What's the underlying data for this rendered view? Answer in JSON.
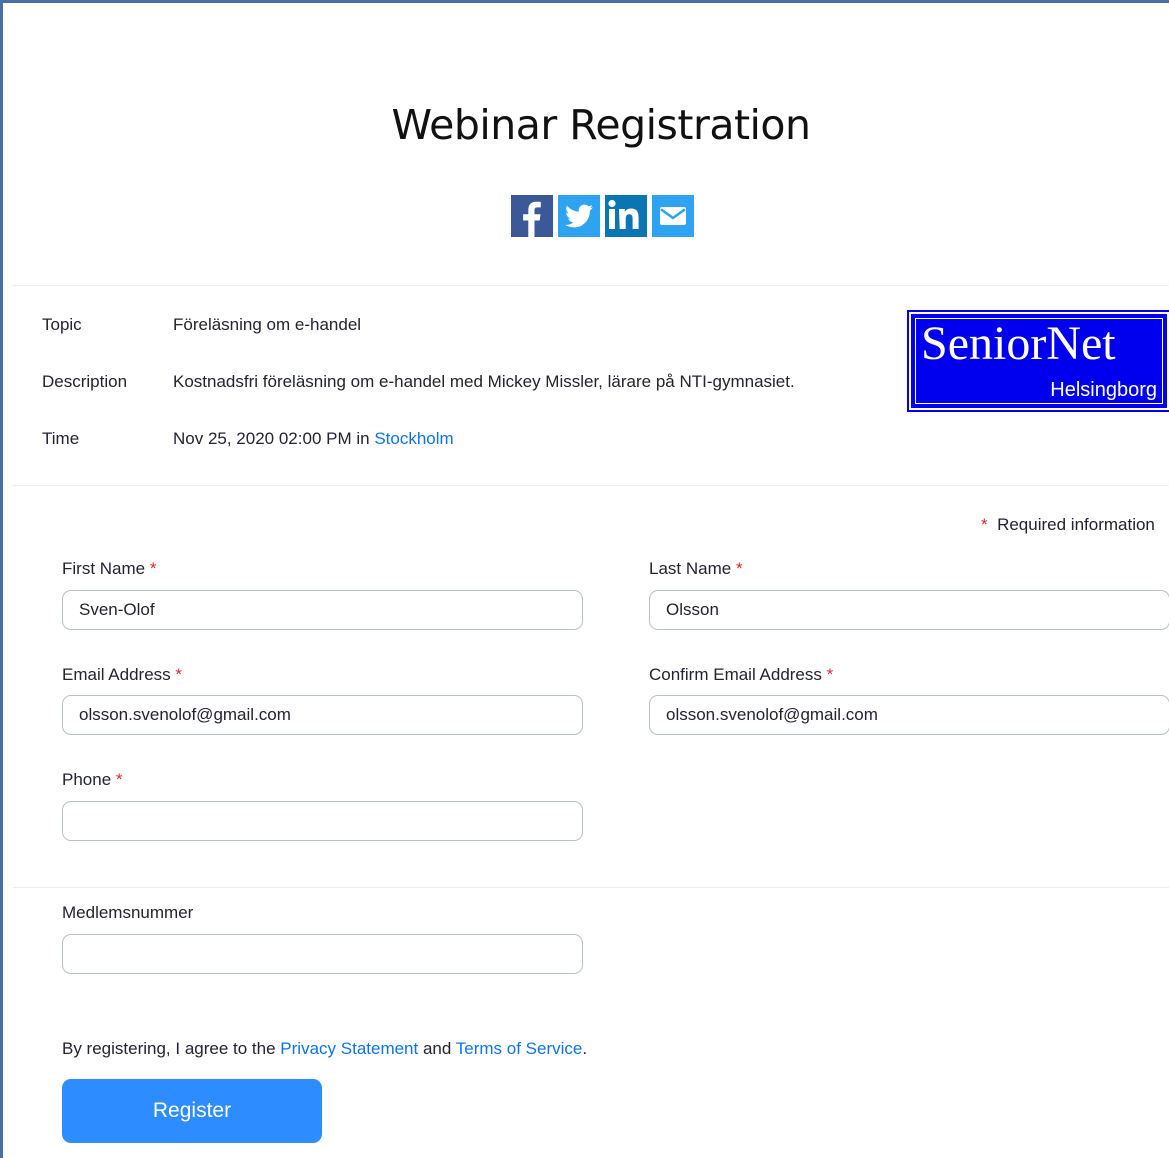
{
  "header": {
    "title": "Webinar Registration"
  },
  "share": {
    "facebook_icon": "facebook-icon",
    "twitter_icon": "twitter-icon",
    "linkedin_icon": "linkedin-icon",
    "email_icon": "email-icon",
    "colors": {
      "facebook": "#3b5998",
      "twitter": "#2ea3f2",
      "linkedin": "#0a75b3",
      "email": "#2ea3f2"
    }
  },
  "info": {
    "topic_label": "Topic",
    "topic_value": "Föreläsning om e-handel",
    "description_label": "Description",
    "description_value": "Kostnadsfri föreläsning om e-handel med Mickey Missler, lärare på NTI-gymnasiet.",
    "time_label": "Time",
    "time_value": "Nov 25, 2020 02:00 PM in",
    "time_zone_link": "Stockholm"
  },
  "logo": {
    "main_text": "SeniorNet",
    "sub_text": "Helsingborg",
    "color": "#0000ee"
  },
  "form": {
    "required_star": "*",
    "required_note": "Required information",
    "first_name": {
      "label": "First Name",
      "value": "Sven-Olof",
      "placeholder": ""
    },
    "last_name": {
      "label": "Last Name",
      "value": "Olsson",
      "placeholder": ""
    },
    "email": {
      "label": "Email Address",
      "value": "olsson.svenolof@gmail.com",
      "placeholder": ""
    },
    "confirm_email": {
      "label": "Confirm Email Address",
      "value": "olsson.svenolof@gmail.com",
      "placeholder": ""
    },
    "phone": {
      "label": "Phone",
      "value": "",
      "placeholder": ""
    },
    "member_number": {
      "label": "Medlemsnummer",
      "value": "",
      "placeholder": ""
    }
  },
  "agreement": {
    "prefix": "By registering, I agree to the ",
    "privacy_link": "Privacy Statement",
    "middle": " and ",
    "terms_link": "Terms of Service",
    "suffix": "."
  },
  "actions": {
    "register_label": "Register",
    "accent_color": "#2d8cff",
    "link_color": "#0e72ed",
    "required_color": "#e02828"
  }
}
